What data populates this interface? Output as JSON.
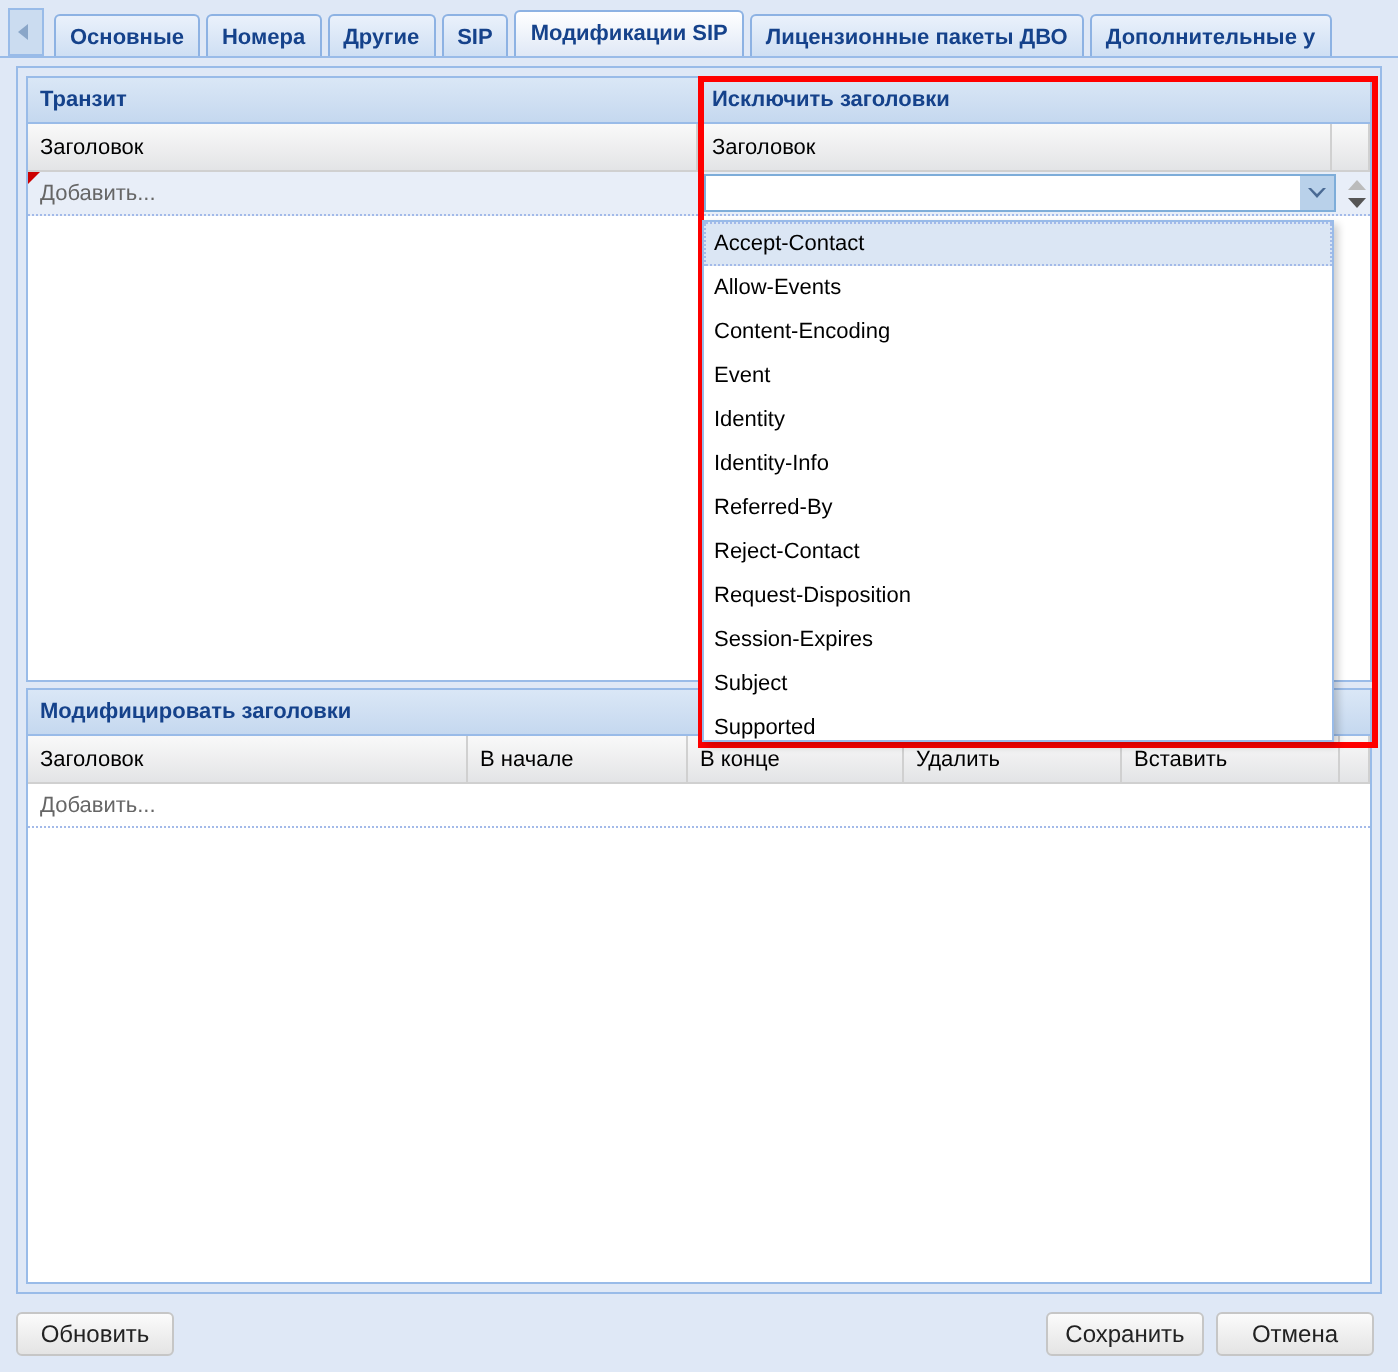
{
  "tabs": [
    {
      "label": "Основные",
      "selected": false
    },
    {
      "label": "Номера",
      "selected": false
    },
    {
      "label": "Другие",
      "selected": false
    },
    {
      "label": "SIP",
      "selected": false
    },
    {
      "label": "Модификации SIP",
      "selected": true
    },
    {
      "label": "Лицензионные пакеты ДВО",
      "selected": false
    },
    {
      "label": "Дополнительные у",
      "selected": false
    }
  ],
  "transit": {
    "title": "Транзит",
    "columns": [
      "Заголовок"
    ],
    "add_row": {
      "text": "Добавить...",
      "modified": true
    }
  },
  "exclude": {
    "title": "Исключить заголовки",
    "columns": [
      "Заголовок"
    ],
    "options": [
      {
        "label": "Accept-Contact",
        "selected": true
      },
      {
        "label": "Allow-Events",
        "selected": false
      },
      {
        "label": "Content-Encoding",
        "selected": false
      },
      {
        "label": "Event",
        "selected": false
      },
      {
        "label": "Identity",
        "selected": false
      },
      {
        "label": "Identity-Info",
        "selected": false
      },
      {
        "label": "Referred-By",
        "selected": false
      },
      {
        "label": "Reject-Contact",
        "selected": false
      },
      {
        "label": "Request-Disposition",
        "selected": false
      },
      {
        "label": "Session-Expires",
        "selected": false
      },
      {
        "label": "Subject",
        "selected": false
      },
      {
        "label": "Supported",
        "selected": false
      }
    ]
  },
  "modify": {
    "title": "Модифицировать заголовки",
    "columns": [
      "Заголовок",
      "В начале",
      "В конце",
      "Удалить",
      "Вставить"
    ],
    "add_row": {
      "text": "Добавить...",
      "modified": false
    }
  },
  "buttons_left": [
    "Обновить"
  ],
  "buttons_right": [
    "Сохранить",
    "Отмена"
  ]
}
